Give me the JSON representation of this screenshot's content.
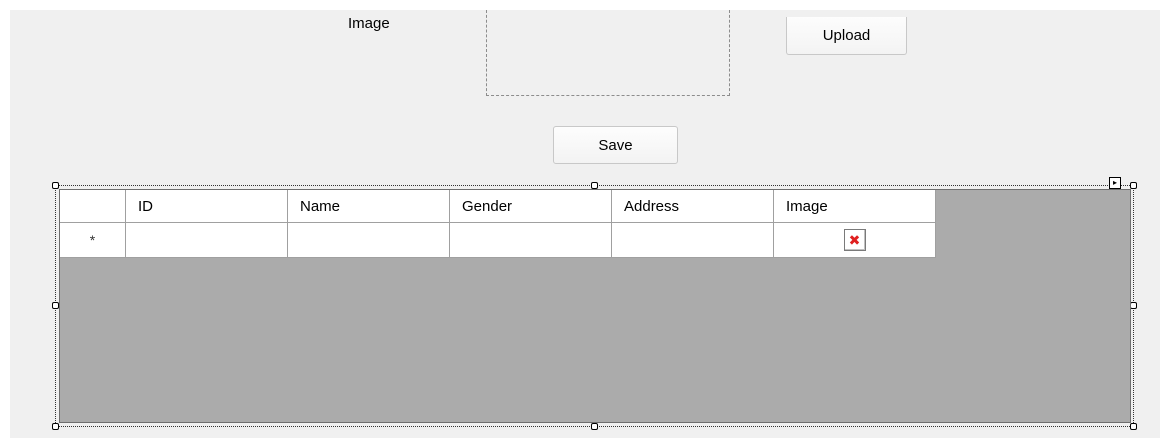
{
  "form": {
    "image_label": "Image",
    "upload_button": "Upload",
    "save_button": "Save"
  },
  "grid": {
    "columns": [
      "ID",
      "Name",
      "Gender",
      "Address",
      "Image"
    ],
    "new_row_indicator": "*",
    "missing_image_icon": "broken-image-icon"
  },
  "colors": {
    "form_background": "#f0f0f0",
    "grid_background": "#ababab",
    "missing_image_x": "#e02020"
  }
}
